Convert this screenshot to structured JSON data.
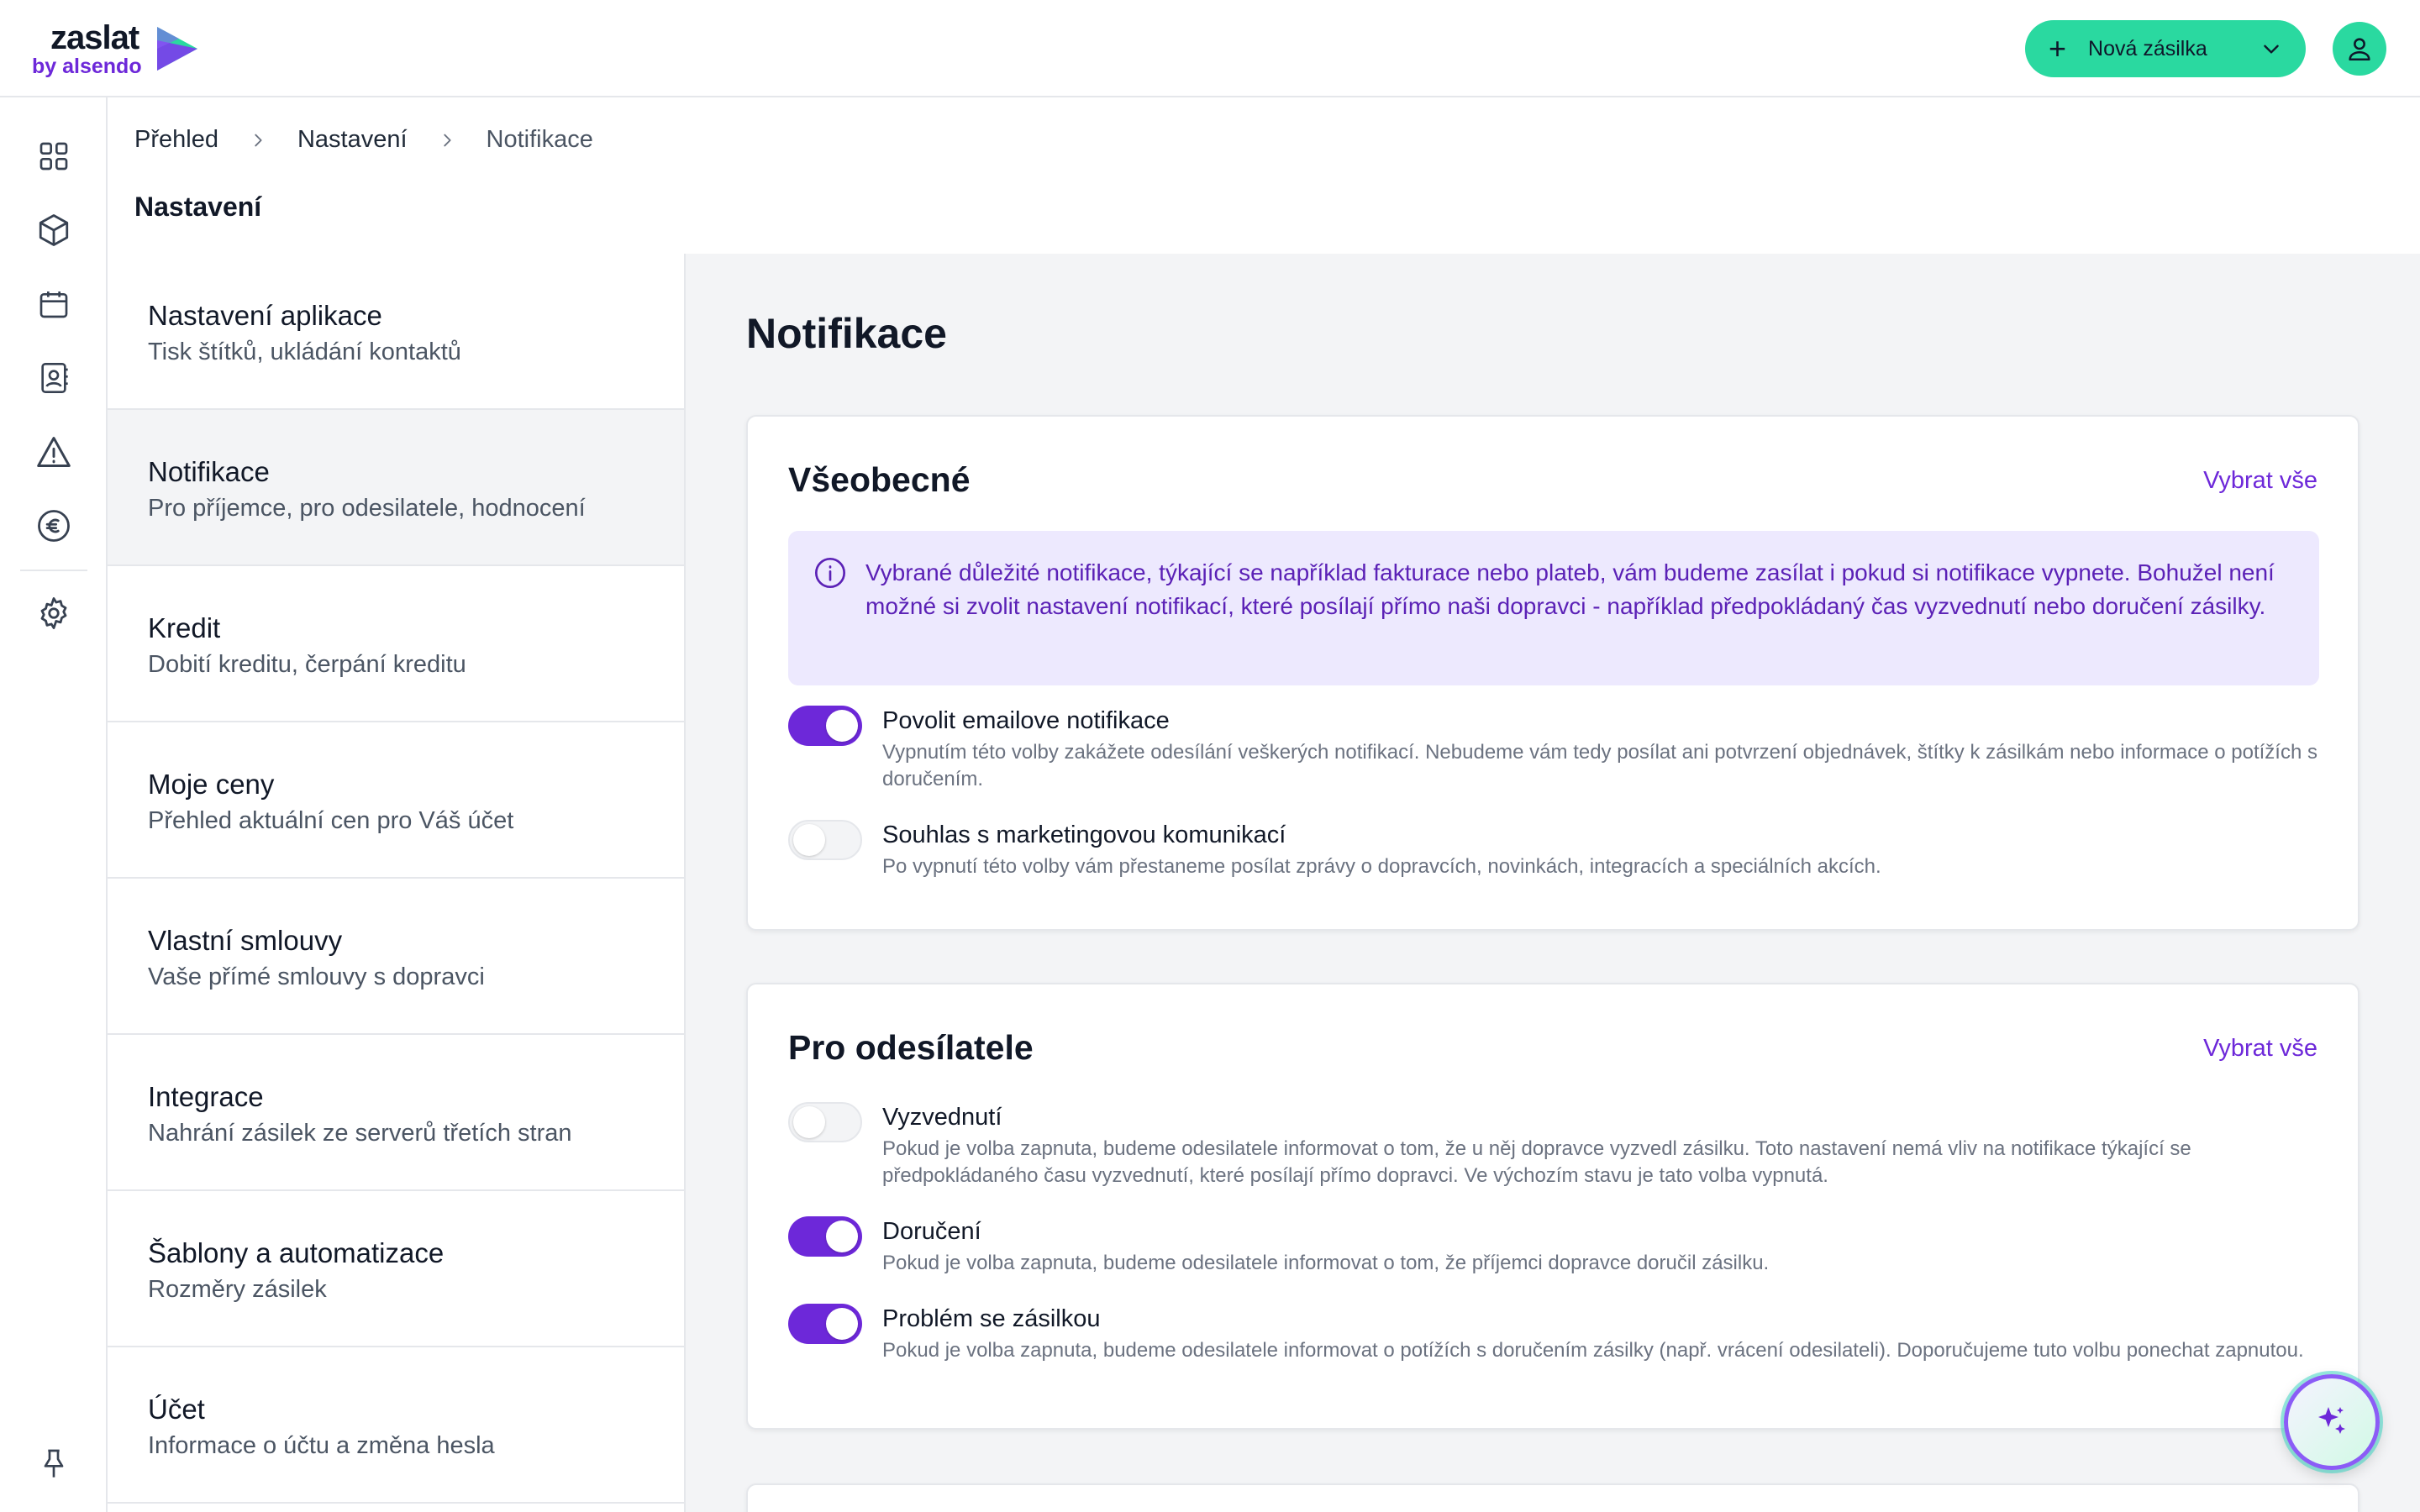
{
  "header": {
    "logo_main": "zaslat",
    "logo_sub": "by alsendo",
    "new_shipment_label": "Nová zásilka"
  },
  "rail": {
    "icons": [
      "dashboard-icon",
      "package-icon",
      "calendar-icon",
      "contacts-icon",
      "warning-icon",
      "euro-icon",
      "gear-icon",
      "pin-icon"
    ]
  },
  "breadcrumb": [
    "Přehled",
    "Nastavení",
    "Notifikace"
  ],
  "page_title": "Nastavení",
  "settings_menu": [
    {
      "title": "Nastavení aplikace",
      "subtitle": "Tisk štítků, ukládání kontaktů"
    },
    {
      "title": "Notifikace",
      "subtitle": "Pro příjemce, pro odesilatele, hodnocení",
      "active": true
    },
    {
      "title": "Kredit",
      "subtitle": "Dobití kreditu, čerpání kreditu"
    },
    {
      "title": "Moje ceny",
      "subtitle": "Přehled aktuální cen pro Váš účet"
    },
    {
      "title": "Vlastní smlouvy",
      "subtitle": "Vaše přímé smlouvy s dopravci"
    },
    {
      "title": "Integrace",
      "subtitle": "Nahrání zásilek ze serverů třetích stran"
    },
    {
      "title": "Šablony a automatizace",
      "subtitle": "Rozměry zásilek"
    },
    {
      "title": "Účet",
      "subtitle": "Informace o účtu a změna hesla"
    }
  ],
  "main": {
    "title": "Notifikace",
    "general": {
      "title": "Všeobecné",
      "select_all": "Vybrat vše",
      "info": "Vybrané důležité notifikace, týkající se například fakturace nebo plateb, vám budeme zasílat i pokud si notifikace vypnete. Bohužel není možné si zvolit nastavení notifikací, které posílají přímo naši dopravci - například předpokládaný čas vyzvednutí nebo doručení zásilky.",
      "options": [
        {
          "title": "Povolit emailove notifikace",
          "desc": "Vypnutím této volby zakážete odesílání veškerých notifikací. Nebudeme vám tedy posílat ani potvrzení objednávek, štítky k zásilkám nebo informace o potížích s doručením.",
          "enabled": true
        },
        {
          "title": "Souhlas s marketingovou komunikací",
          "desc": "Po vypnutí této volby vám přestaneme posílat zprávy o dopravcích, novinkách, integracích a speciálních akcích.",
          "enabled": false
        }
      ]
    },
    "sender": {
      "title": "Pro odesílatele",
      "select_all": "Vybrat vše",
      "options": [
        {
          "title": "Vyzvednutí",
          "desc": "Pokud je volba zapnuta, budeme odesilatele informovat o tom, že u něj dopravce vyzvedl zásilku. Toto nastavení nemá vliv na notifikace týkající se předpokládaného času vyzvednutí, které posílají přímo dopravci. Ve výchozím stavu je tato volba vypnutá.",
          "enabled": false
        },
        {
          "title": "Doručení",
          "desc": "Pokud je volba zapnuta, budeme odesilatele informovat o tom, že příjemci dopravce doručil zásilku.",
          "enabled": true
        },
        {
          "title": "Problém se zásilkou",
          "desc": "Pokud je volba zapnuta, budeme odesilatele informovat o potížích s doručením zásilky (např. vrácení odesilateli). Doporučujeme tuto volbu ponechat zapnutou.",
          "enabled": true
        }
      ]
    }
  },
  "colors": {
    "accent": "#6d28d9",
    "brand_green": "#2ad9a0",
    "info_bg": "#ede9fe"
  }
}
